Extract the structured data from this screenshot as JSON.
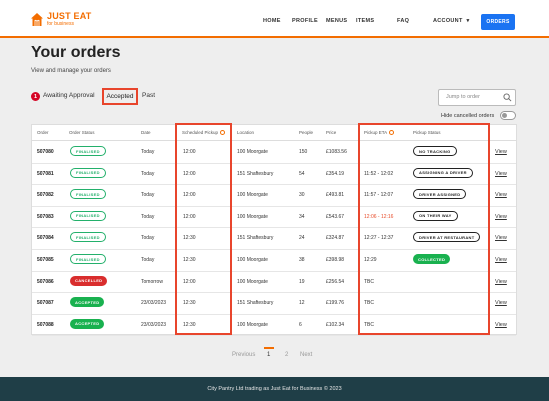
{
  "header": {
    "logo_main": "JUST EAT",
    "logo_sub": "for business",
    "nav": [
      "HOME",
      "PROFILE",
      "MENUS",
      "ITEMS",
      "FAQ",
      "ACCOUNT"
    ],
    "account_caret": "▾",
    "orders_button": "ORDERS",
    "accent_color": "#f36d00",
    "button_color": "#1a73f2"
  },
  "page": {
    "title": "Your orders",
    "subtitle": "View and manage your orders"
  },
  "tabs": {
    "awaiting_count": "1",
    "awaiting": "Awaiting Approval",
    "accepted": "Accepted",
    "past": "Past"
  },
  "search": {
    "placeholder": "Jump to order",
    "icon": "search-icon"
  },
  "filters": {
    "hide_cancelled": "Hide cancelled orders",
    "hide_cancelled_on": false
  },
  "table": {
    "headers": [
      "Order",
      "Order Status",
      "Date",
      "Scheduled Pickup",
      "Location",
      "People",
      "Price",
      "Pickup ETA",
      "Pickup Status"
    ],
    "view_label": "View",
    "rows": [
      {
        "order": "507080",
        "status": "FINALISED",
        "status_style": "finalised",
        "date": "Today",
        "pickup": "12:00",
        "location": "100 Moorgate",
        "people": "150",
        "price": "£1083.56",
        "eta": "",
        "eta_red": false,
        "pickup_status": "NO TRACKING",
        "ps_style": "outline"
      },
      {
        "order": "507081",
        "status": "FINALISED",
        "status_style": "finalised",
        "date": "Today",
        "pickup": "12:00",
        "location": "151 Shaftesbury",
        "people": "54",
        "price": "£354.19",
        "eta": "11:52 - 12:02",
        "eta_red": false,
        "pickup_status": "ASSIGNING A DRIVER",
        "ps_style": "outline"
      },
      {
        "order": "507082",
        "status": "FINALISED",
        "status_style": "finalised",
        "date": "Today",
        "pickup": "12:00",
        "location": "100 Moorgate",
        "people": "30",
        "price": "£493.81",
        "eta": "11:57 - 12:07",
        "eta_red": false,
        "pickup_status": "DRIVER ASSIGNED",
        "ps_style": "outline"
      },
      {
        "order": "507083",
        "status": "FINALISED",
        "status_style": "finalised",
        "date": "Today",
        "pickup": "12:00",
        "location": "100 Moorgate",
        "people": "34",
        "price": "£543.67",
        "eta": "12:06 - 12:16",
        "eta_red": true,
        "pickup_status": "ON THEIR WAY",
        "ps_style": "outline"
      },
      {
        "order": "507084",
        "status": "FINALISED",
        "status_style": "finalised",
        "date": "Today",
        "pickup": "12:30",
        "location": "151 Shaftesbury",
        "people": "24",
        "price": "£324.87",
        "eta": "12:27 - 12:37",
        "eta_red": false,
        "pickup_status": "DRIVER AT RESTAURANT",
        "ps_style": "outline"
      },
      {
        "order": "507085",
        "status": "FINALISED",
        "status_style": "finalised",
        "date": "Today",
        "pickup": "12:30",
        "location": "100 Moorgate",
        "people": "38",
        "price": "£398.98",
        "eta": "12:29",
        "eta_red": false,
        "pickup_status": "COLLECTED",
        "ps_style": "green"
      },
      {
        "order": "507086",
        "status": "CANCELLED",
        "status_style": "cancelled",
        "date": "Tomorrow",
        "pickup": "12:00",
        "location": "100 Moorgate",
        "people": "19",
        "price": "£256.54",
        "eta": "TBC",
        "eta_red": false,
        "pickup_status": "",
        "ps_style": "none"
      },
      {
        "order": "507087",
        "status": "ACCEPTED",
        "status_style": "accepted",
        "date": "23/03/2023",
        "pickup": "12:30",
        "location": "151 Shaftesbury",
        "people": "12",
        "price": "£199.76",
        "eta": "TBC",
        "eta_red": false,
        "pickup_status": "",
        "ps_style": "none"
      },
      {
        "order": "507088",
        "status": "ACCEPTED",
        "status_style": "accepted",
        "date": "23/03/2023",
        "pickup": "12:30",
        "location": "100 Moorgate",
        "people": "6",
        "price": "£102.34",
        "eta": "TBC",
        "eta_red": false,
        "pickup_status": "",
        "ps_style": "none"
      }
    ]
  },
  "pagination": {
    "previous": "Previous",
    "pages": [
      "1",
      "2"
    ],
    "current": "1",
    "next": "Next"
  },
  "footer": {
    "text": "City Pantry Ltd trading as Just Eat for Business © 2023"
  }
}
